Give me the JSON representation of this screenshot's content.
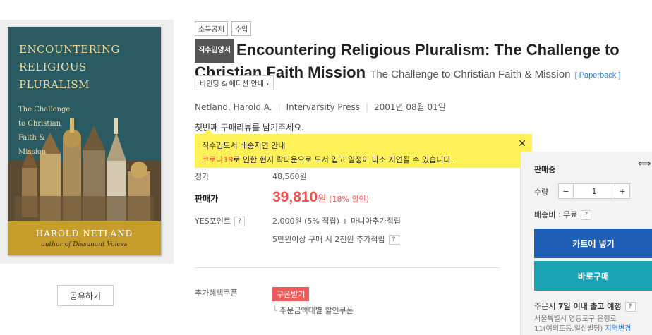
{
  "cover": {
    "title_lines": [
      "ENCOUNTERING",
      "RELIGIOUS",
      "PLURALISM"
    ],
    "subtitle_lines": [
      "The Challenge",
      "to Christian",
      "Faith &",
      "Mission"
    ],
    "author": "HAROLD NETLAND",
    "tagline": "author of Dissonant Voices"
  },
  "share_label": "공유하기",
  "tags": [
    "소득공제",
    "수입"
  ],
  "badge": "직수입양서",
  "title": "Encountering Religious Pluralism: The Challenge to Christian Faith Mission",
  "subtitle": "The Challenge to Christian Faith & Mission",
  "format": "[ Paperback ]",
  "binding_label": "바인딩 & 에디션 안내",
  "meta": {
    "author": "Netland, Harold A.",
    "publisher": "Intervarsity Press",
    "date": "2001년 08월 01일"
  },
  "review_prompt": "첫번째 구매리뷰를 남겨주세요.",
  "notice": {
    "title": "직수입도서 배송지연 안내",
    "highlight": "코로나19",
    "body": "로 인한 현지 락다운으로 도서 입고 일정이 다소 지연될 수 있습니다."
  },
  "price": {
    "list_label": "정가",
    "list_value": "48,560원",
    "sale_label": "판매가",
    "sale_value": "39,810",
    "won": "원",
    "discount": "(18% 할인)",
    "points_label": "YES포인트",
    "points_value": "2,000원 (5% 적립) + 마니아추가적립",
    "points_extra": "5만원이상 구매 시 2천원 추가적립"
  },
  "coupon": {
    "label": "추가혜택쿠폰",
    "button": "쿠폰받기",
    "desc": "주문금액대별 할인쿠폰"
  },
  "panel": {
    "status": "판매중",
    "qty_label": "수량",
    "qty": "1",
    "shipping": "배송비 : 무료",
    "cart": "카트에 넣기",
    "buy": "바로구매",
    "order_pre": "주문시",
    "order_days": "7일 이내",
    "order_post": "출고 예정",
    "addr_line1": "서울특별시 영등포구 은행로",
    "addr_line2": "11(여의도동,일신빌딩)",
    "addr_link": "지역변경"
  }
}
